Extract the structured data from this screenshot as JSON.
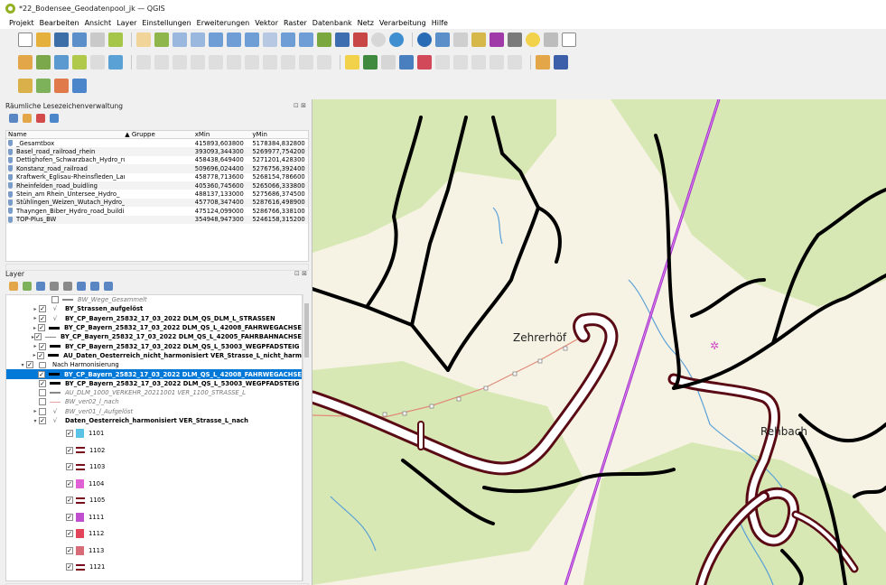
{
  "window": {
    "title": "*22_Bodensee_Geodatenpool_jk — QGIS"
  },
  "menu": [
    "Projekt",
    "Bearbeiten",
    "Ansicht",
    "Layer",
    "Einstellungen",
    "Erweiterungen",
    "Vektor",
    "Raster",
    "Datenbank",
    "Netz",
    "Verarbeitung",
    "Hilfe"
  ],
  "bookmarks_panel": {
    "title": "Räumliche Lesezeichenverwaltung",
    "columns": [
      "Name",
      "Gruppe",
      "xMin",
      "yMin"
    ],
    "rows": [
      {
        "name": "_Gesamtbox",
        "group": "",
        "xmin": "415893,603800",
        "ymin": "5178384,832800"
      },
      {
        "name": "Basel_road_railroad_rhein",
        "group": "",
        "xmin": "393093,344300",
        "ymin": "5269977,754200"
      },
      {
        "name": "Dettighofen_Schwarzbach_Hydro_road",
        "group": "",
        "xmin": "458438,649400",
        "ymin": "5271201,428300"
      },
      {
        "name": "Konstanz_road_railroad",
        "group": "",
        "xmin": "509696,024400",
        "ymin": "5276756,392400"
      },
      {
        "name": "Kraftwerk_Eglisau-Rheinsfleden_Lan...",
        "group": "",
        "xmin": "458778,713600",
        "ymin": "5268154,786600"
      },
      {
        "name": "Rheinfelden_road_buidling",
        "group": "",
        "xmin": "405360,745600",
        "ymin": "5265066,333800"
      },
      {
        "name": "Stein_am Rhein_Untersee_Hydro_",
        "group": "",
        "xmin": "488137,133000",
        "ymin": "5275686,374500"
      },
      {
        "name": "Stühlingen_Weizen_Wutach_Hydro_r...",
        "group": "",
        "xmin": "457708,347400",
        "ymin": "5287616,498900"
      },
      {
        "name": "Thayngen_Biber_Hydro_road_building",
        "group": "",
        "xmin": "475124,099000",
        "ymin": "5286766,338100"
      },
      {
        "name": "TOP-Plus_BW",
        "group": "",
        "xmin": "354948,947300",
        "ymin": "5246158,315200"
      }
    ]
  },
  "layer_panel": {
    "title": "Layer",
    "layers": [
      {
        "label": "BW_Wege_Gesammelt",
        "indent": 3,
        "checked": false,
        "style": "italic",
        "symbol": "line",
        "arrow": ""
      },
      {
        "label": "BY_Strassen_aufgelöst",
        "indent": 2,
        "checked": true,
        "style": "bold",
        "symbol": "v",
        "arrow": "▸"
      },
      {
        "label": "BY_CP_Bayern_25832_17_03_2022 DLM_QS_DLM_L_STRASSEN",
        "indent": 2,
        "checked": true,
        "style": "bold",
        "symbol": "v",
        "arrow": "▸"
      },
      {
        "label": "BY_CP_Bayern_25832_17_03_2022 DLM_QS_L_42008_FAHRWEGACHSE",
        "indent": 2,
        "checked": true,
        "style": "bold",
        "symbol": "thick",
        "arrow": "▸"
      },
      {
        "label": "BY_CP_Bayern_25832_17_03_2022 DLM_QS_L_42005_FAHRBAHNACHSE",
        "indent": 2,
        "checked": true,
        "style": "bold",
        "symbol": "line",
        "arrow": "▸"
      },
      {
        "label": "BY_CP_Bayern_25832_17_03_2022 DLM_QS_L_53003_WEGPFADSTEIG",
        "indent": 2,
        "checked": true,
        "style": "bold",
        "symbol": "thick",
        "arrow": "▸"
      },
      {
        "label": "AU_Daten_Oesterreich_nicht_harmonisiert VER_Strasse_L_nicht_harm",
        "indent": 2,
        "checked": true,
        "style": "bold",
        "symbol": "thick",
        "arrow": "▸"
      },
      {
        "label": "Nach Harmonisierung",
        "indent": 1,
        "checked": true,
        "style": "normal",
        "symbol": "group",
        "arrow": "▾"
      },
      {
        "label": "BY_CP_Bayern_25832_17_03_2022 DLM_QS_L_42008_FAHRWEGACHSE",
        "indent": 2,
        "checked": true,
        "style": "bold",
        "symbol": "thick",
        "arrow": "",
        "selected": true
      },
      {
        "label": "BY_CP_Bayern_25832_17_03_2022 DLM_QS_L_53003_WEGPFADSTEIG",
        "indent": 2,
        "checked": true,
        "style": "bold",
        "symbol": "thick",
        "arrow": ""
      },
      {
        "label": "AU_DLM_1000_VERKEHR_20211001 VER_1100_STRASSE_L",
        "indent": 2,
        "checked": false,
        "style": "italic",
        "symbol": "line",
        "arrow": ""
      },
      {
        "label": "BW_ver02_l_nach",
        "indent": 2,
        "checked": false,
        "style": "italic",
        "symbol": "pink",
        "arrow": ""
      },
      {
        "label": "BW_ver01_l_Aufgelöst",
        "indent": 2,
        "checked": false,
        "style": "italic",
        "symbol": "v",
        "arrow": "▸"
      },
      {
        "label": "Daten_Oesterreich_harmonisiert VER_Strasse_L_nach",
        "indent": 2,
        "checked": true,
        "style": "bold",
        "symbol": "v",
        "arrow": "▾"
      }
    ],
    "classes": [
      {
        "label": "1101",
        "kind": "swatch",
        "color": "#5bc4e6"
      },
      {
        "label": "1102",
        "kind": "line",
        "color": "#7a0c1b"
      },
      {
        "label": "1103",
        "kind": "line",
        "color": "#7a0c1b"
      },
      {
        "label": "1104",
        "kind": "swatch",
        "color": "#e060d6"
      },
      {
        "label": "1105",
        "kind": "line",
        "color": "#7a0c1b"
      },
      {
        "label": "1111",
        "kind": "swatch",
        "color": "#c04fd0"
      },
      {
        "label": "1112",
        "kind": "swatch",
        "color": "#e2455a"
      },
      {
        "label": "1113",
        "kind": "swatch",
        "color": "#d76b78"
      },
      {
        "label": "1121",
        "kind": "line",
        "color": "#7a0c1b"
      }
    ]
  },
  "map": {
    "labels": [
      "Zehrerhöf",
      "Rehbach"
    ]
  }
}
